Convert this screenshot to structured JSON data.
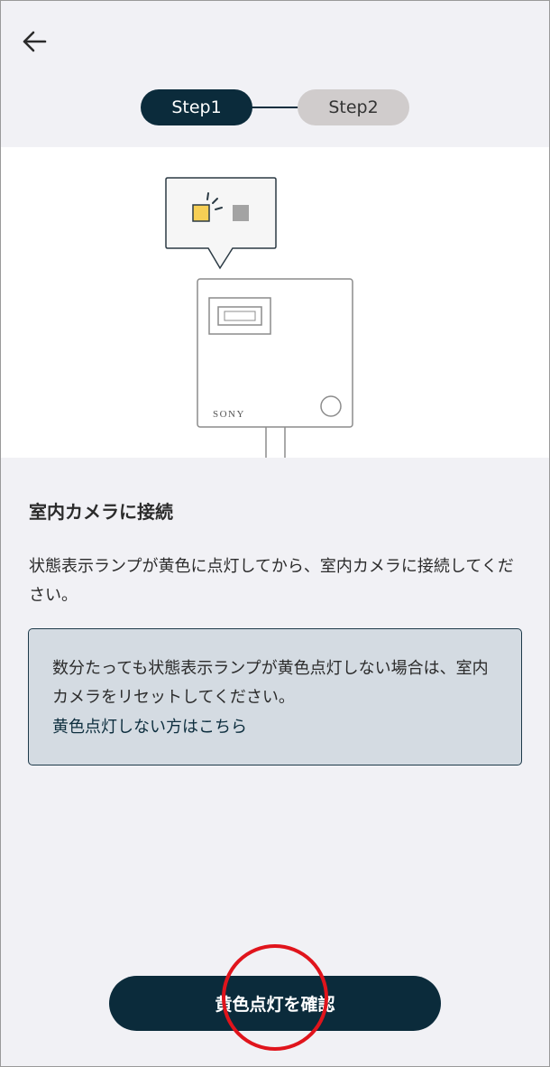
{
  "header": {
    "back_icon": "arrow-left-icon"
  },
  "stepper": {
    "steps": [
      {
        "label": "Step1",
        "state": "active"
      },
      {
        "label": "Step2",
        "state": "inactive"
      }
    ]
  },
  "illustration": {
    "brand_label": "SONY",
    "lamp_on_color": "#f6cf55",
    "lamp_off_color": "#a3a3a3"
  },
  "content": {
    "title": "室内カメラに接続",
    "description": "状態表示ランプが黄色に点灯してから、室内カメラに接続してください。",
    "notice_text": "数分たっても状態表示ランプが黄色点灯しない場合は、室内カメラをリセットしてください。",
    "notice_link": "黄色点灯しない方はこちら"
  },
  "footer": {
    "confirm_label": "黄色点灯を確認"
  },
  "colors": {
    "primary": "#0b2b3b",
    "inactive_step": "#d0cccc",
    "notice_bg": "#d4dbe2",
    "tap_marker": "#e0141c"
  }
}
